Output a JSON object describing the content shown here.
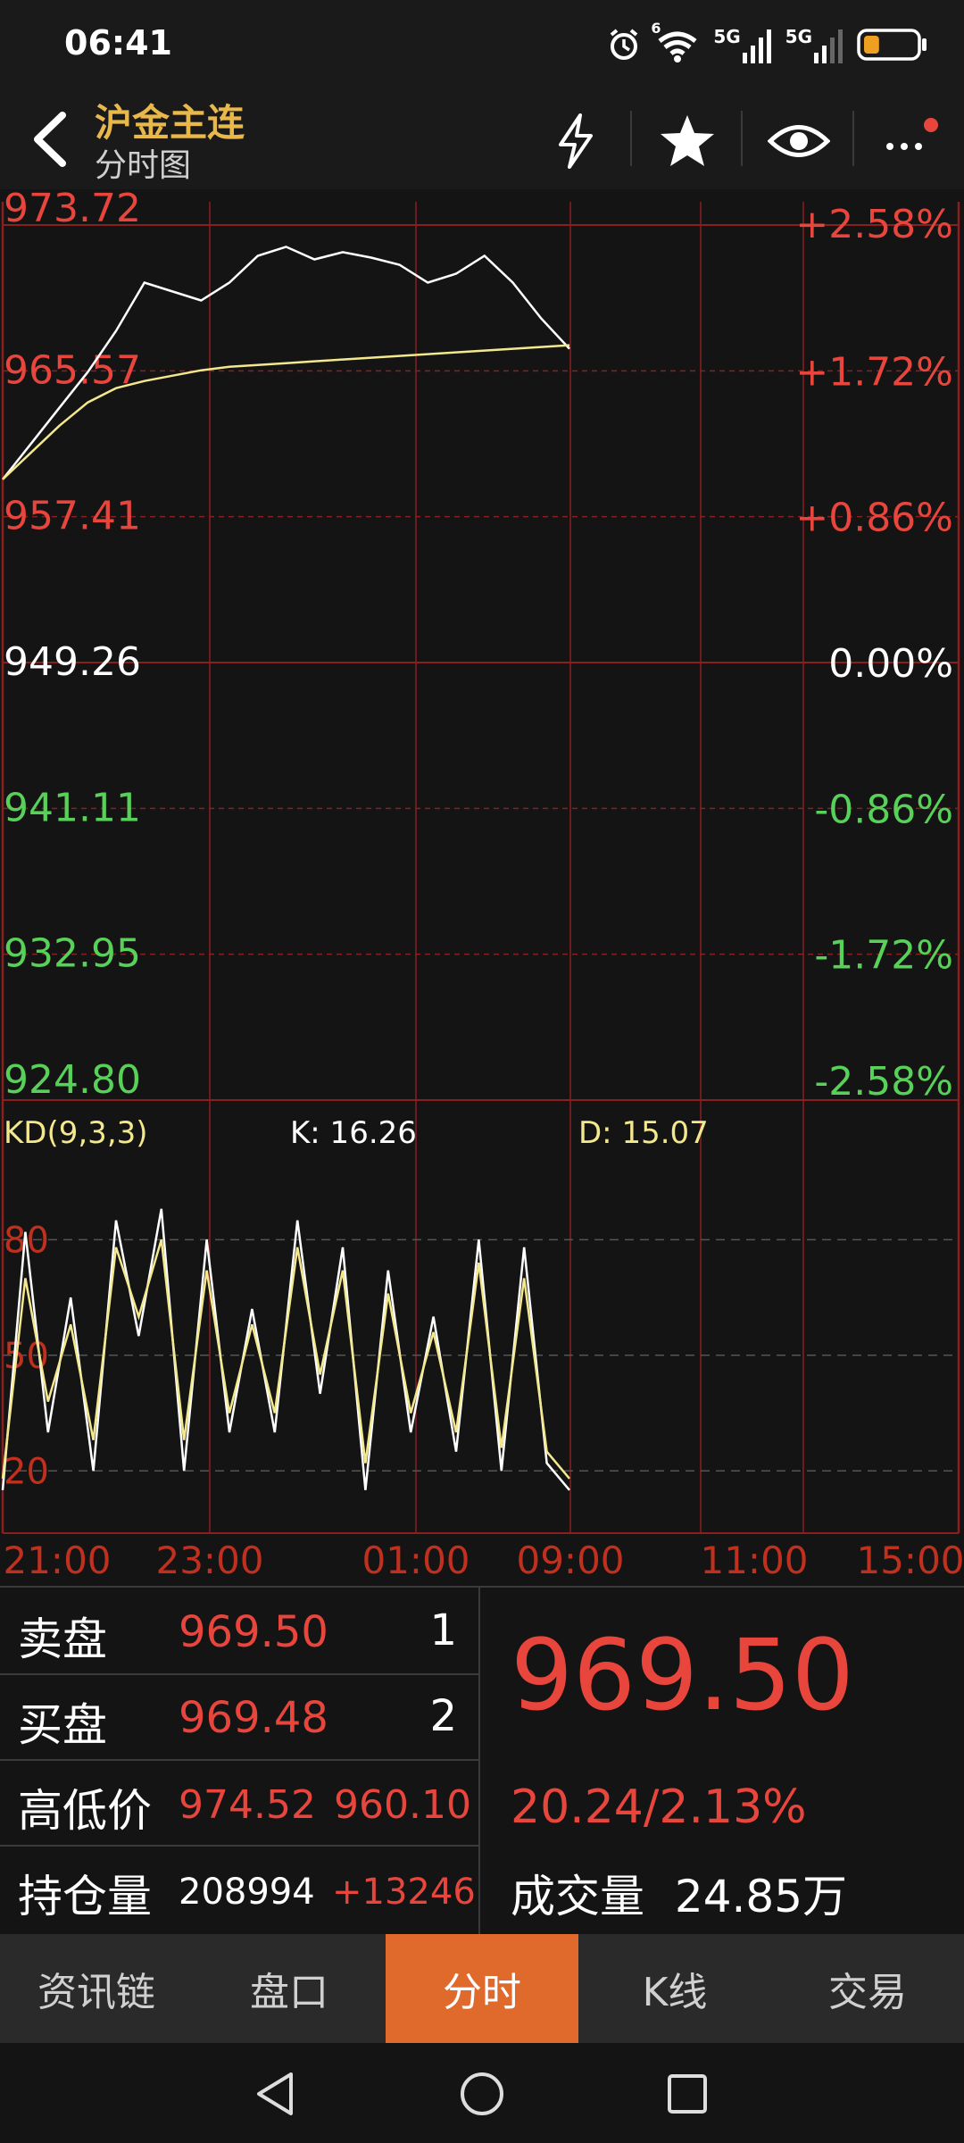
{
  "status_bar": {
    "time": "06:41",
    "icons": [
      "alarm-icon",
      "wifi-icon",
      "signal-5g-icon",
      "signal-5g-icon",
      "battery-icon"
    ],
    "network1": "5G",
    "network2": "5G",
    "wifi_badge": "6",
    "battery_level_fraction": 0.3
  },
  "header": {
    "title": "沪金主连",
    "subtitle": "分时图",
    "actions": [
      "flash-icon",
      "star-icon",
      "eye-icon",
      "more-icon"
    ],
    "colors": {
      "title": "#e8b84a",
      "notification_dot": "#e8463c"
    }
  },
  "price_axis": {
    "left_labels": [
      {
        "text": "973.72",
        "color": "#e8463c"
      },
      {
        "text": "965.57",
        "color": "#e8463c"
      },
      {
        "text": "957.41",
        "color": "#e8463c"
      },
      {
        "text": "949.26",
        "color": "#ffffff"
      },
      {
        "text": "941.11",
        "color": "#58d158"
      },
      {
        "text": "932.95",
        "color": "#58d158"
      },
      {
        "text": "924.80",
        "color": "#58d158"
      }
    ],
    "right_labels": [
      {
        "text": "+2.58%",
        "color": "#e8463c"
      },
      {
        "text": "+1.72%",
        "color": "#e8463c"
      },
      {
        "text": "+0.86%",
        "color": "#e8463c"
      },
      {
        "text": "0.00%",
        "color": "#ffffff"
      },
      {
        "text": "-0.86%",
        "color": "#58d158"
      },
      {
        "text": "-1.72%",
        "color": "#58d158"
      },
      {
        "text": "-2.58%",
        "color": "#58d158"
      }
    ]
  },
  "kd": {
    "name": "KD(9,3,3)",
    "k_label": "K: 16.26",
    "d_label": "D: 15.07",
    "levels": [
      "80",
      "50",
      "20"
    ]
  },
  "time_axis": [
    "21:00",
    "23:00",
    "01:00",
    "09:00",
    "11:00",
    "15:00"
  ],
  "chart_data": [
    {
      "type": "line",
      "title": "",
      "ylim": [
        924.8,
        973.72
      ],
      "x": [
        0,
        5,
        10,
        15,
        20,
        25,
        30,
        35,
        40,
        45,
        50,
        55,
        60,
        65,
        70,
        75,
        80,
        85,
        90,
        95,
        100
      ],
      "series": [
        {
          "values": [
            959.5,
            961.5,
            963.5,
            965.5,
            967.8,
            970.5,
            970.0,
            969.5,
            970.5,
            972.0,
            972.5,
            971.8,
            972.2,
            971.9,
            971.5,
            970.5,
            971.0,
            972.0,
            970.5,
            968.5,
            966.8
          ]
        },
        {
          "values": [
            959.5,
            961.0,
            962.5,
            963.8,
            964.6,
            965.0,
            965.3,
            965.6,
            965.8,
            965.9,
            966.0,
            966.1,
            966.2,
            966.3,
            966.4,
            966.5,
            966.6,
            966.7,
            966.8,
            966.9,
            967.0
          ]
        }
      ]
    },
    {
      "type": "line",
      "title": "",
      "ylim": [
        5,
        100
      ],
      "x": [
        0,
        4,
        8,
        12,
        16,
        20,
        24,
        28,
        32,
        36,
        40,
        44,
        48,
        52,
        56,
        60,
        64,
        68,
        72,
        76,
        80,
        84,
        88,
        92,
        96,
        100
      ],
      "series": [
        {
          "values": [
            15,
            82,
            30,
            65,
            20,
            85,
            55,
            88,
            20,
            80,
            30,
            62,
            30,
            85,
            40,
            78,
            15,
            72,
            30,
            60,
            25,
            80,
            20,
            78,
            22,
            15
          ]
        },
        {
          "values": [
            18,
            70,
            38,
            58,
            28,
            78,
            60,
            80,
            28,
            72,
            35,
            58,
            35,
            78,
            45,
            72,
            22,
            66,
            35,
            56,
            30,
            74,
            26,
            70,
            25,
            18
          ]
        }
      ]
    }
  ],
  "quote": {
    "ask_label": "卖盘",
    "ask_price": "969.50",
    "ask_qty": "1",
    "bid_label": "买盘",
    "bid_price": "969.48",
    "bid_qty": "2",
    "hl_label": "高低价",
    "high": "974.52",
    "low": "960.10",
    "oi_label": "持仓量",
    "open_interest": "208994",
    "oi_change": "+13246",
    "last_price": "969.50",
    "change": "20.24/2.13%",
    "volume_label": "成交量",
    "volume": "24.85万"
  },
  "bottom_tabs": [
    "资讯链",
    "盘口",
    "分时",
    "K线",
    "交易"
  ],
  "active_tab": 2
}
